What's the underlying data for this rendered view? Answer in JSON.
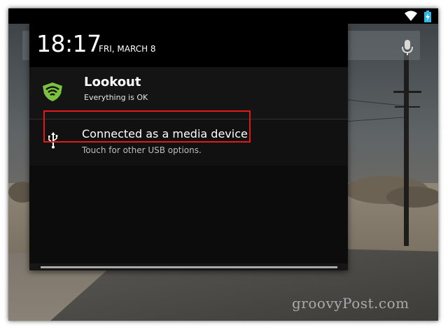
{
  "clock": {
    "time": "18:17",
    "date": "FRI, MARCH 8"
  },
  "notifications": [
    {
      "app": "Lookout",
      "text": "Everything is OK",
      "icon": "lookout-shield-icon"
    },
    {
      "title": "Connected as a media device",
      "text": "Touch for other USB options.",
      "icon": "usb-icon"
    }
  ],
  "status_bar": {
    "icons": [
      "wifi-icon",
      "battery-charging-icon"
    ]
  },
  "watermark": "groovyPost.com",
  "colors": {
    "highlight": "#e0191b",
    "lookout_green": "#7cc23f",
    "battery_blue": "#33b5e5"
  }
}
